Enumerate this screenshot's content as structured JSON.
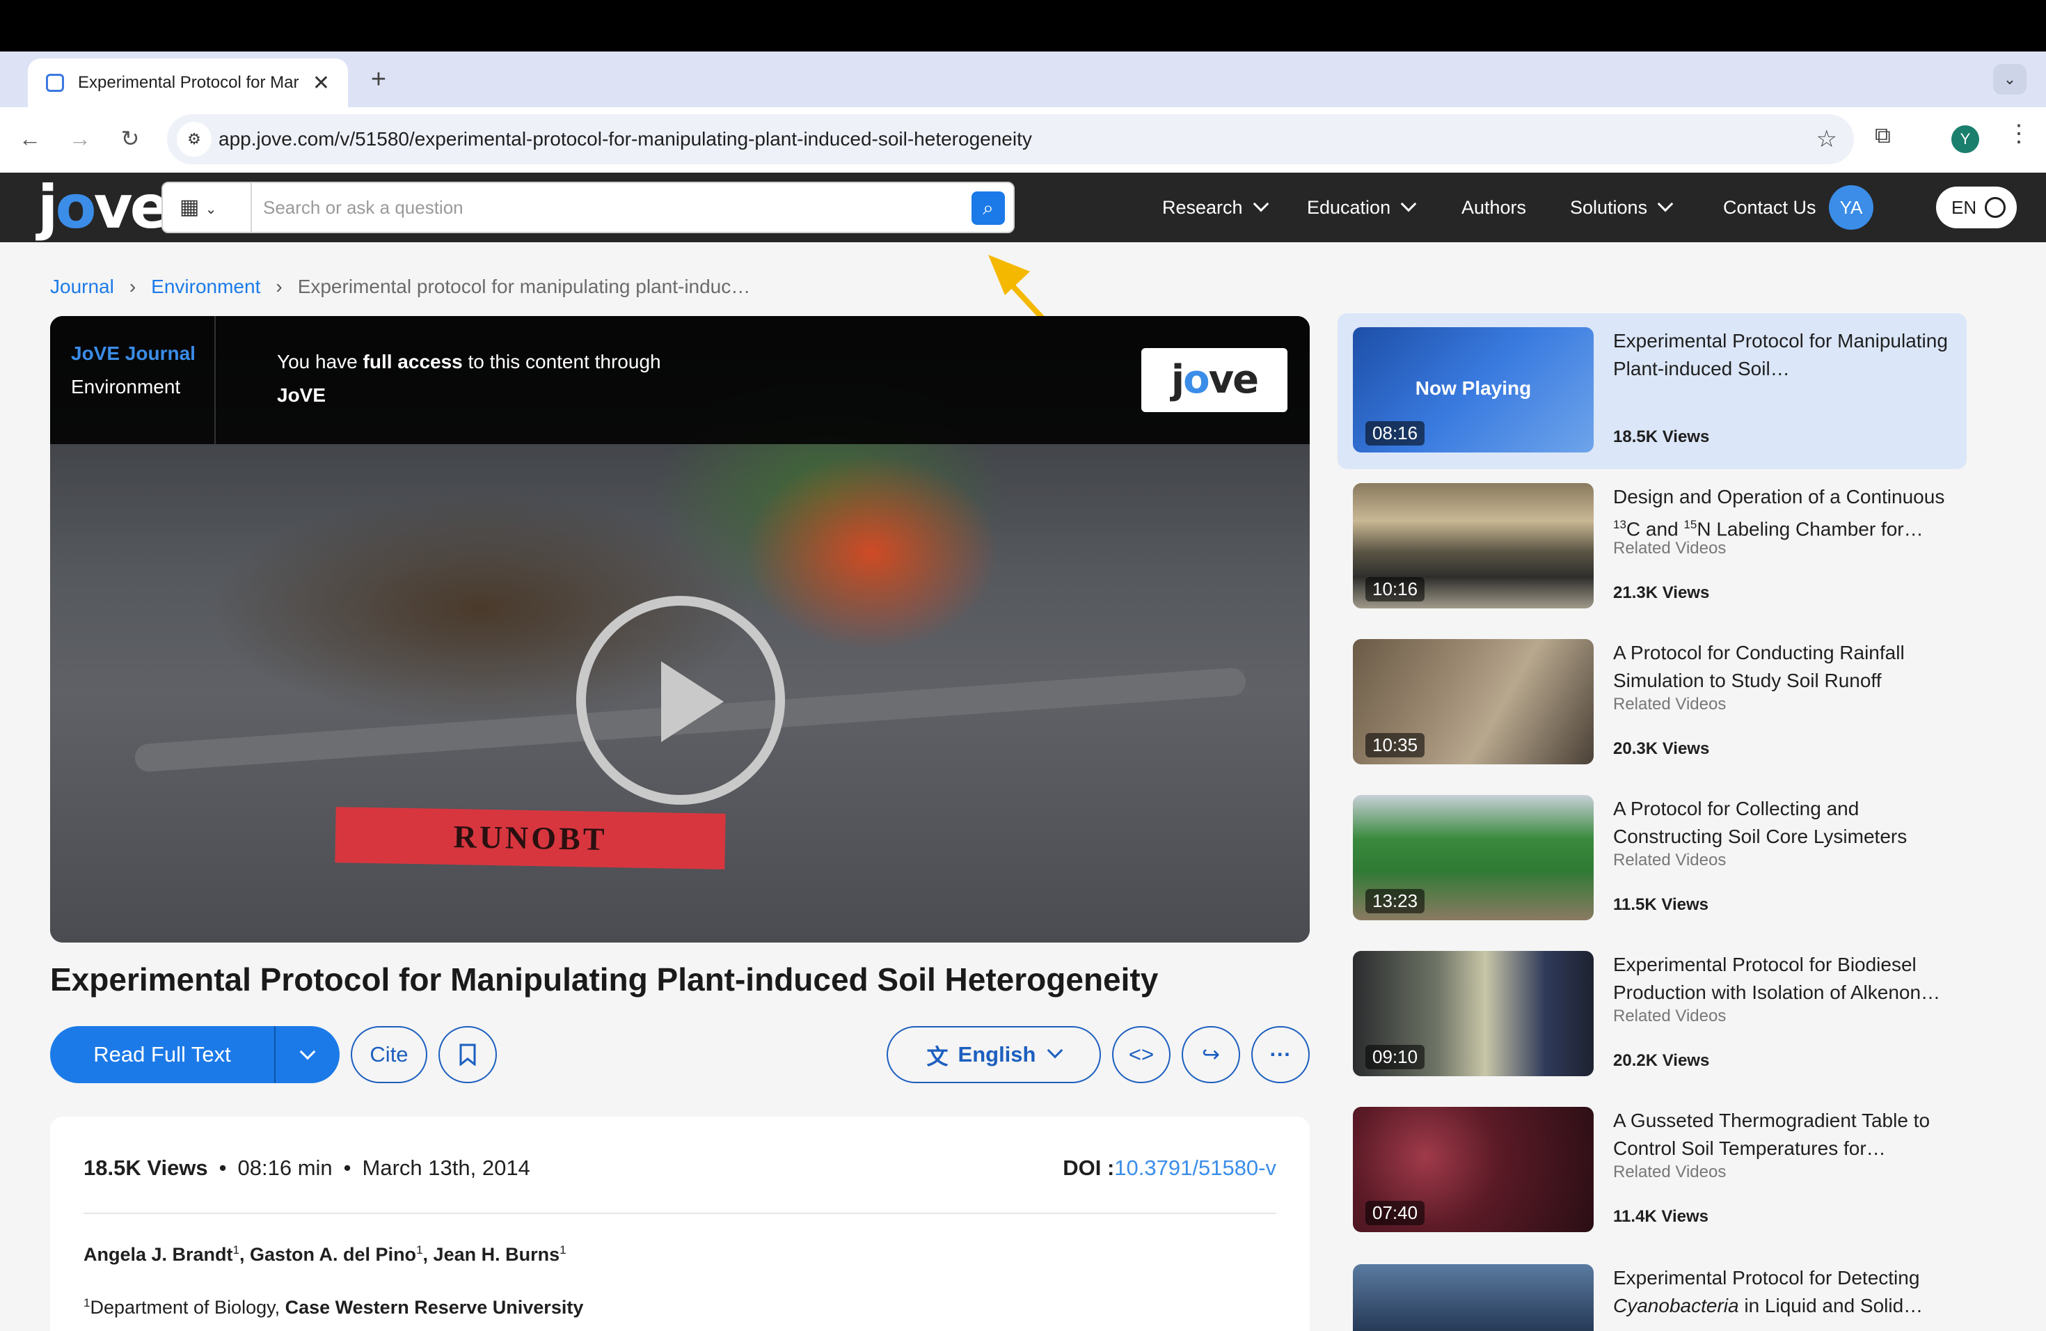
{
  "browser": {
    "tab_title": "Experimental Protocol for Mar",
    "tab_close": "✕",
    "new_tab": "+",
    "url": "app.jove.com/v/51580/experimental-protocol-for-manipulating-plant-induced-soil-heterogeneity",
    "profile_initial": "Y"
  },
  "site": {
    "logo_left": "j",
    "logo_o": "o",
    "logo_right": "ve",
    "search_placeholder": "Search or ask a question",
    "nav": {
      "research": "Research",
      "education": "Education",
      "authors": "Authors",
      "solutions": "Solutions",
      "contact": "Contact Us"
    },
    "user_initials": "YA",
    "language": "EN"
  },
  "breadcrumb": {
    "journal": "Journal",
    "environment": "Environment",
    "current": "Experimental protocol for manipulating plant-induc…"
  },
  "player": {
    "journal_label": "JoVE Journal",
    "section_label": "Environment",
    "access_pre": "You have ",
    "access_bold": "full access",
    "access_post": " to this content through",
    "access_org": "JoVE",
    "badge_left": "j",
    "badge_o": "o",
    "badge_right": "ve",
    "tape_text": "RUNOBT"
  },
  "article": {
    "title": "Experimental Protocol for Manipulating Plant-induced Soil Heterogeneity",
    "read_full_text": "Read Full Text",
    "cite": "Cite",
    "language": "English",
    "views": "18.5K Views",
    "duration": "08:16 min",
    "date": "March 13th, 2014",
    "doi_label": "DOI :",
    "doi_value": "10.3791/51580-v",
    "authors": [
      {
        "name": "Angela J. Brandt",
        "sup": "1"
      },
      {
        "name": "Gaston A. del Pino",
        "sup": "1"
      },
      {
        "name": "Jean H. Burns",
        "sup": "1"
      }
    ],
    "affiliation_sup": "1",
    "affiliation_dept": "Department of Biology, ",
    "affiliation_univ": "Case Western Reserve University"
  },
  "related": [
    {
      "title": "Experimental Protocol for Manipulating Plant-induced Soil…",
      "duration": "08:16",
      "views": "18.5K Views",
      "now_playing": "Now Playing",
      "category": ""
    },
    {
      "title_pre": "Design and Operation of a Continuous ",
      "sup1": "13",
      "title_mid": "C and ",
      "sup2": "15",
      "title_post": "N Labeling Chamber for…",
      "duration": "10:16",
      "views": "21.3K Views",
      "category": "Related Videos"
    },
    {
      "title": "A Protocol for Conducting Rainfall Simulation to Study Soil Runoff",
      "duration": "10:35",
      "views": "20.3K Views",
      "category": "Related Videos"
    },
    {
      "title": "A Protocol for Collecting and Constructing Soil Core Lysimeters",
      "duration": "13:23",
      "views": "11.5K Views",
      "category": "Related Videos"
    },
    {
      "title": "Experimental Protocol for Biodiesel Production with Isolation of Alkenon…",
      "duration": "09:10",
      "views": "20.2K Views",
      "category": "Related Videos"
    },
    {
      "title": "A Gusseted Thermogradient Table to Control Soil Temperatures for…",
      "duration": "07:40",
      "views": "11.4K Views",
      "category": "Related Videos"
    },
    {
      "title_pre": "Experimental Protocol for Detecting ",
      "title_italic": "Cyanobacteria",
      "title_post": " in Liquid and Solid…"
    }
  ],
  "colors": {
    "brand_blue": "#1c7ae8",
    "header_dark": "#262626",
    "annotation_arrow": "#f5b800"
  }
}
